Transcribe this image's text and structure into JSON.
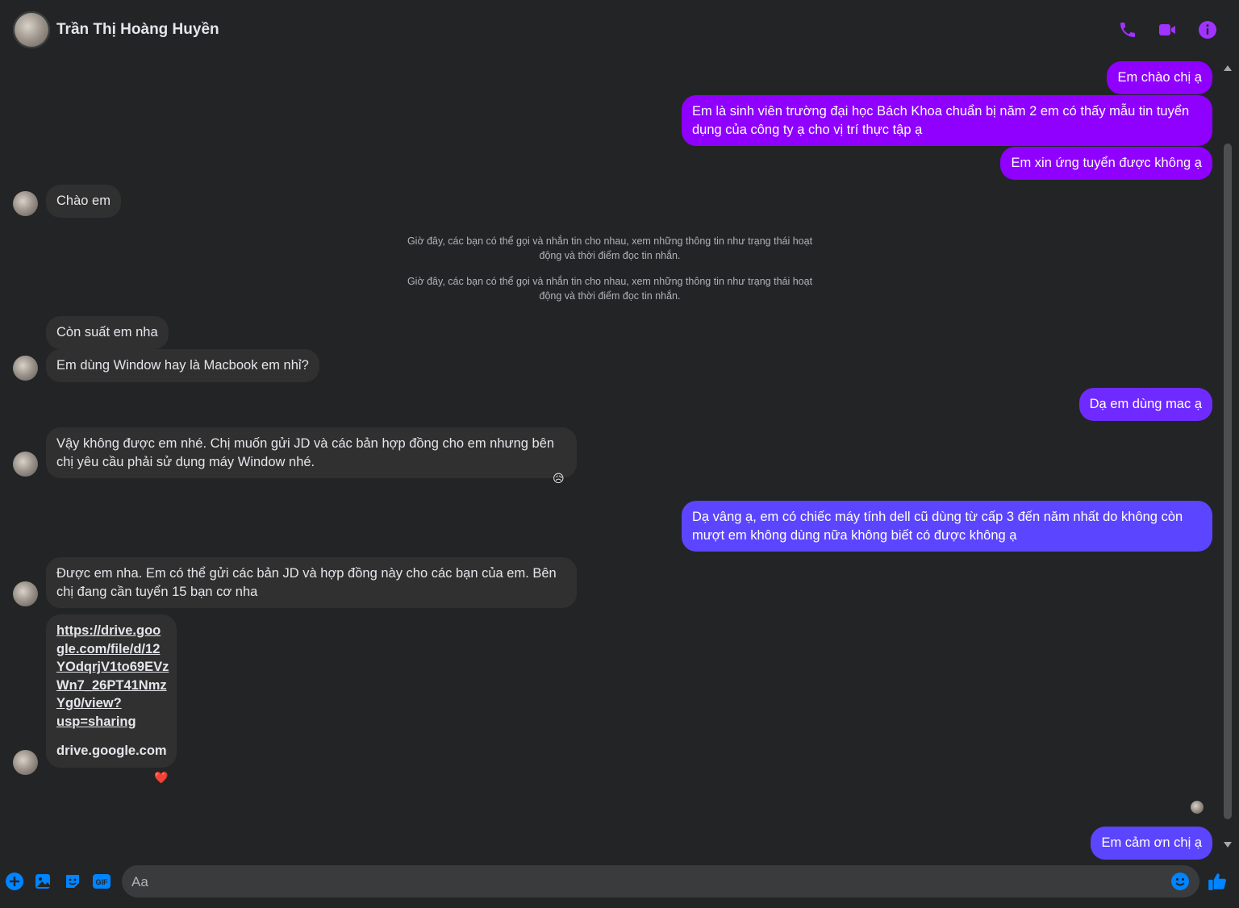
{
  "header": {
    "contact_name": "Trần Thị Hoàng Huyền",
    "icons": [
      "phone-icon",
      "video-call-icon",
      "info-icon"
    ]
  },
  "messages": {
    "out1": "Em chào chị ạ",
    "out2": "Em là sinh viên trường đại học Bách Khoa chuẩn bị năm 2 em có thấy mẫu tin tuyển dụng của công ty ạ cho vị trí thực tập ạ",
    "out3": "Em xin ứng tuyển được không ạ",
    "in1": "Chào em",
    "system1": "Giờ đây, các bạn có thể gọi và nhắn tin cho nhau, xem những thông tin như trạng thái hoạt động và thời điểm đọc tin nhắn.",
    "system2": "Giờ đây, các bạn có thể gọi và nhắn tin cho nhau, xem những thông tin như trạng thái hoạt động và thời điểm đọc tin nhắn.",
    "in2": "Còn suất em nha",
    "in3": "Em dùng Window hay là Macbook em nhỉ?",
    "out4": "Dạ em dùng mac ạ",
    "in4": "Vậy không được em nhé. Chị muốn gửi JD và các bản hợp đồng cho em nhưng bên chị yêu cầu phải sử dụng máy Window nhé.",
    "in4_reaction": "😥",
    "out5": "Dạ vâng ạ, em có chiếc máy tính dell cũ dùng từ cấp 3 đến năm nhất do không còn mượt em không dùng nữa không biết có được không ạ",
    "in5": "Được em nha. Em có thể gửi các bản JD và hợp đồng này cho các bạn của em. Bên chị đang cần tuyển 15 bạn cơ nha",
    "in6_link": "https://drive.google.com/file/d/12YOdqrjV1to69EVzWn7_26PT41NmzYg0/view?usp=sharing",
    "in6_link_lines": [
      "https://drive.goo",
      "gle.com/file/d/12",
      "YOdqrjV1to69EVz",
      "Wn7_26PT41Nmz",
      "Yg0/view?",
      "usp=sharing"
    ],
    "in6_domain": "drive.google.com",
    "in6_reaction": "❤️",
    "out6": "Em cảm ơn chị ạ"
  },
  "composer": {
    "placeholder": "Aa",
    "icons": [
      "add-icon",
      "image-icon",
      "sticker-icon",
      "gif-icon",
      "emoji-icon",
      "like-icon"
    ]
  },
  "colors": {
    "background": "#232426",
    "outgoing_purple": "#8f00ff",
    "outgoing_blue": "#5c45ff",
    "incoming": "#303030",
    "accent_icon": "#a033ff",
    "composer_icon": "#0084ff"
  }
}
